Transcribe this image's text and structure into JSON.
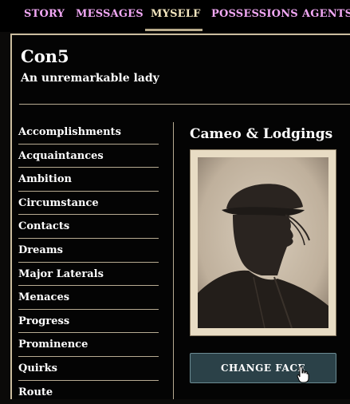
{
  "nav": {
    "tabs": [
      {
        "label": "STORY",
        "active": false
      },
      {
        "label": "MESSAGES",
        "active": false
      },
      {
        "label": "MYSELF",
        "active": true
      },
      {
        "label": "POSSESSIONS",
        "active": false
      },
      {
        "label": "AGENTS",
        "active": false
      }
    ]
  },
  "profile": {
    "name": "Con5",
    "description": "An unremarkable lady"
  },
  "sidebar": {
    "items": [
      {
        "label": "Accomplishments"
      },
      {
        "label": "Acquaintances"
      },
      {
        "label": "Ambition"
      },
      {
        "label": "Circumstance"
      },
      {
        "label": "Contacts"
      },
      {
        "label": "Dreams"
      },
      {
        "label": "Major Laterals"
      },
      {
        "label": "Menaces"
      },
      {
        "label": "Progress"
      },
      {
        "label": "Prominence"
      },
      {
        "label": "Quirks"
      },
      {
        "label": "Route"
      }
    ]
  },
  "cameo": {
    "title": "Cameo & Lodgings",
    "image": "silhouette-portrait",
    "button_label": "CHANGE FACE"
  },
  "colors": {
    "tab_link": "#f2a8f5",
    "tab_active": "#f4e6bf",
    "button_bg": "#2b4148",
    "frame": "#e8dcc4"
  }
}
